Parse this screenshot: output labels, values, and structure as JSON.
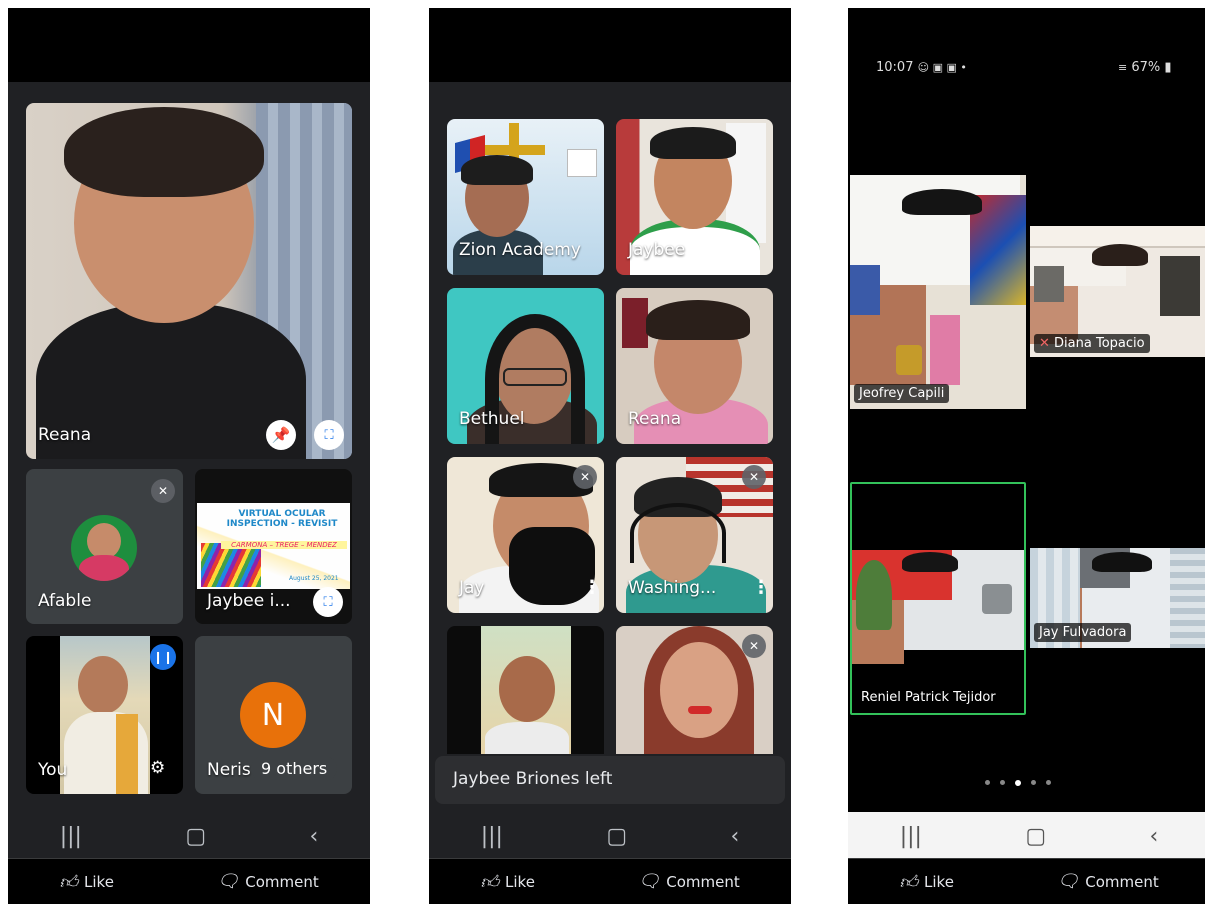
{
  "panel1": {
    "main_tile": {
      "name": "Reana"
    },
    "tiles": [
      {
        "name": "Afable"
      },
      {
        "name": "Jaybee i...",
        "slide_title": "VIRTUAL OCULAR INSPECTION - REVISIT",
        "slide_subtitle": "CARMONA – TREGE – MENDEZ",
        "slide_date": "August 25, 2021"
      },
      {
        "name": "You"
      },
      {
        "name": "Neris",
        "avatar_letter": "N",
        "others_label": "9 others"
      }
    ]
  },
  "panel2": {
    "tiles": [
      {
        "name": "Zion Academy"
      },
      {
        "name": "Jaybee"
      },
      {
        "name": "Bethuel"
      },
      {
        "name": "Reana"
      },
      {
        "name": "Jay"
      },
      {
        "name": "Washing..."
      },
      {
        "name": ""
      },
      {
        "name": ""
      }
    ],
    "toast": "Jaybee Briones left"
  },
  "panel3": {
    "status_time": "10:07",
    "status_battery": "67%",
    "tiles": [
      {
        "name": "Jeofrey Capili"
      },
      {
        "name": "Diana Topacio"
      },
      {
        "name": "Reniel Patrick Tejidor"
      },
      {
        "name": "Jay Fulvadora"
      }
    ]
  },
  "facebook": {
    "like_label": "Like",
    "comment_label": "Comment"
  },
  "colors": {
    "meet_bg": "#202124",
    "active_speaker": "#33c15a",
    "neris_avatar": "#e8710a",
    "afable_avatar": "#1e8e3e"
  }
}
